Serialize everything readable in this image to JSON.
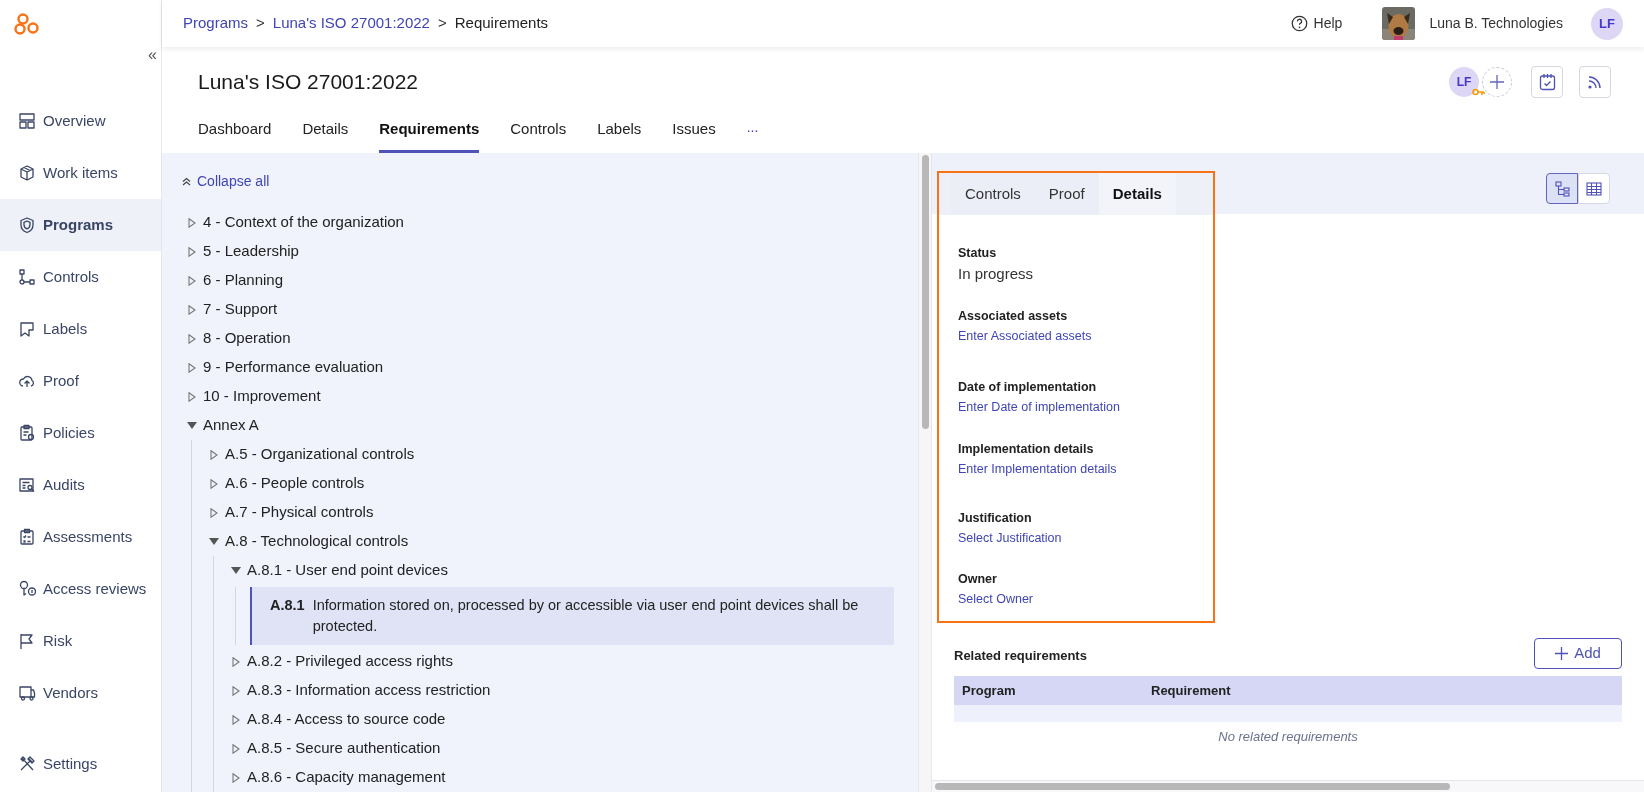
{
  "breadcrumb": [
    {
      "kind": "link",
      "label": "Programs"
    },
    {
      "kind": "separator",
      "label": ">"
    },
    {
      "kind": "link",
      "label": "Luna's ISO 27001:2022"
    },
    {
      "kind": "separator",
      "label": ">"
    },
    {
      "kind": "current",
      "label": "Requirements"
    }
  ],
  "top_bar": {
    "help": "Help",
    "organization": "Luna B. Technologies",
    "user_initials": "LF"
  },
  "sidebar": {
    "collapse": "«",
    "items": [
      {
        "label": "Overview",
        "selected": false
      },
      {
        "label": "Work items",
        "selected": false
      },
      {
        "label": "Programs",
        "selected": true
      },
      {
        "label": "Controls",
        "selected": false
      },
      {
        "label": "Labels",
        "selected": false
      },
      {
        "label": "Proof",
        "selected": false
      },
      {
        "label": "Policies",
        "selected": false
      },
      {
        "label": "Audits",
        "selected": false
      },
      {
        "label": "Assessments",
        "selected": false
      },
      {
        "label": "Access reviews",
        "selected": false
      },
      {
        "label": "Risk",
        "selected": false
      },
      {
        "label": "Vendors",
        "selected": false
      }
    ],
    "settings": "Settings"
  },
  "page": {
    "title": "Luna's ISO 27001:2022",
    "member_initials": "LF",
    "tabs": [
      {
        "label": "Dashboard",
        "selected": false
      },
      {
        "label": "Details",
        "selected": false
      },
      {
        "label": "Requirements",
        "selected": true
      },
      {
        "label": "Controls",
        "selected": false
      },
      {
        "label": "Labels",
        "selected": false
      },
      {
        "label": "Issues",
        "selected": false
      }
    ],
    "more": "..."
  },
  "tree": {
    "collapse_all": "Collapse all",
    "items": [
      {
        "label": "4 - Context of the organization",
        "expanded": false
      },
      {
        "label": "5 - Leadership",
        "expanded": false
      },
      {
        "label": "6 - Planning",
        "expanded": false
      },
      {
        "label": "7 - Support",
        "expanded": false
      },
      {
        "label": "8 - Operation",
        "expanded": false
      },
      {
        "label": "9 - Performance evaluation",
        "expanded": false
      },
      {
        "label": "10 - Improvement",
        "expanded": false
      },
      {
        "label": "Annex A",
        "expanded": true,
        "children": [
          {
            "label": "A.5 - Organizational controls",
            "expanded": false
          },
          {
            "label": "A.6 - People controls",
            "expanded": false
          },
          {
            "label": "A.7 - Physical controls",
            "expanded": false
          },
          {
            "label": "A.8 - Technological controls",
            "expanded": true,
            "children": [
              {
                "label": "A.8.1 - User end point devices",
                "expanded": true,
                "children": [
                  {
                    "kind": "requirement",
                    "code": "A.8.1",
                    "text": "Information stored on, processed by or accessible via user end point devices shall be protected.",
                    "selected": true
                  }
                ]
              },
              {
                "label": "A.8.2 - Privileged access rights",
                "expanded": false
              },
              {
                "label": "A.8.3 - Information access restriction",
                "expanded": false
              },
              {
                "label": "A.8.4 - Access to source code",
                "expanded": false
              },
              {
                "label": "A.8.5 - Secure authentication",
                "expanded": false
              },
              {
                "label": "A.8.6 - Capacity management",
                "expanded": false
              }
            ]
          }
        ]
      }
    ]
  },
  "detail_tabs": [
    {
      "label": "Controls",
      "selected": false
    },
    {
      "label": "Proof",
      "selected": false
    },
    {
      "label": "Details",
      "selected": true
    }
  ],
  "view_toggle": [
    {
      "kind": "tree",
      "selected": true
    },
    {
      "kind": "table",
      "selected": false
    }
  ],
  "details": [
    {
      "label": "Status",
      "value": "In progress",
      "kind": "value"
    },
    {
      "label": "Associated assets",
      "value": "Enter Associated assets",
      "kind": "link"
    },
    {
      "label": "Date of implementation",
      "value": "Enter Date of implementation",
      "kind": "link"
    },
    {
      "label": "Implementation details",
      "value": "Enter Implementation details",
      "kind": "link"
    },
    {
      "label": "Justification",
      "value": "Select Justification",
      "kind": "link"
    },
    {
      "label": "Owner",
      "value": "Select Owner",
      "kind": "link"
    }
  ],
  "related": {
    "title": "Related requirements",
    "add_button": "Add",
    "columns": [
      "Program",
      "Requirement"
    ],
    "empty_text": "No related requirements"
  }
}
